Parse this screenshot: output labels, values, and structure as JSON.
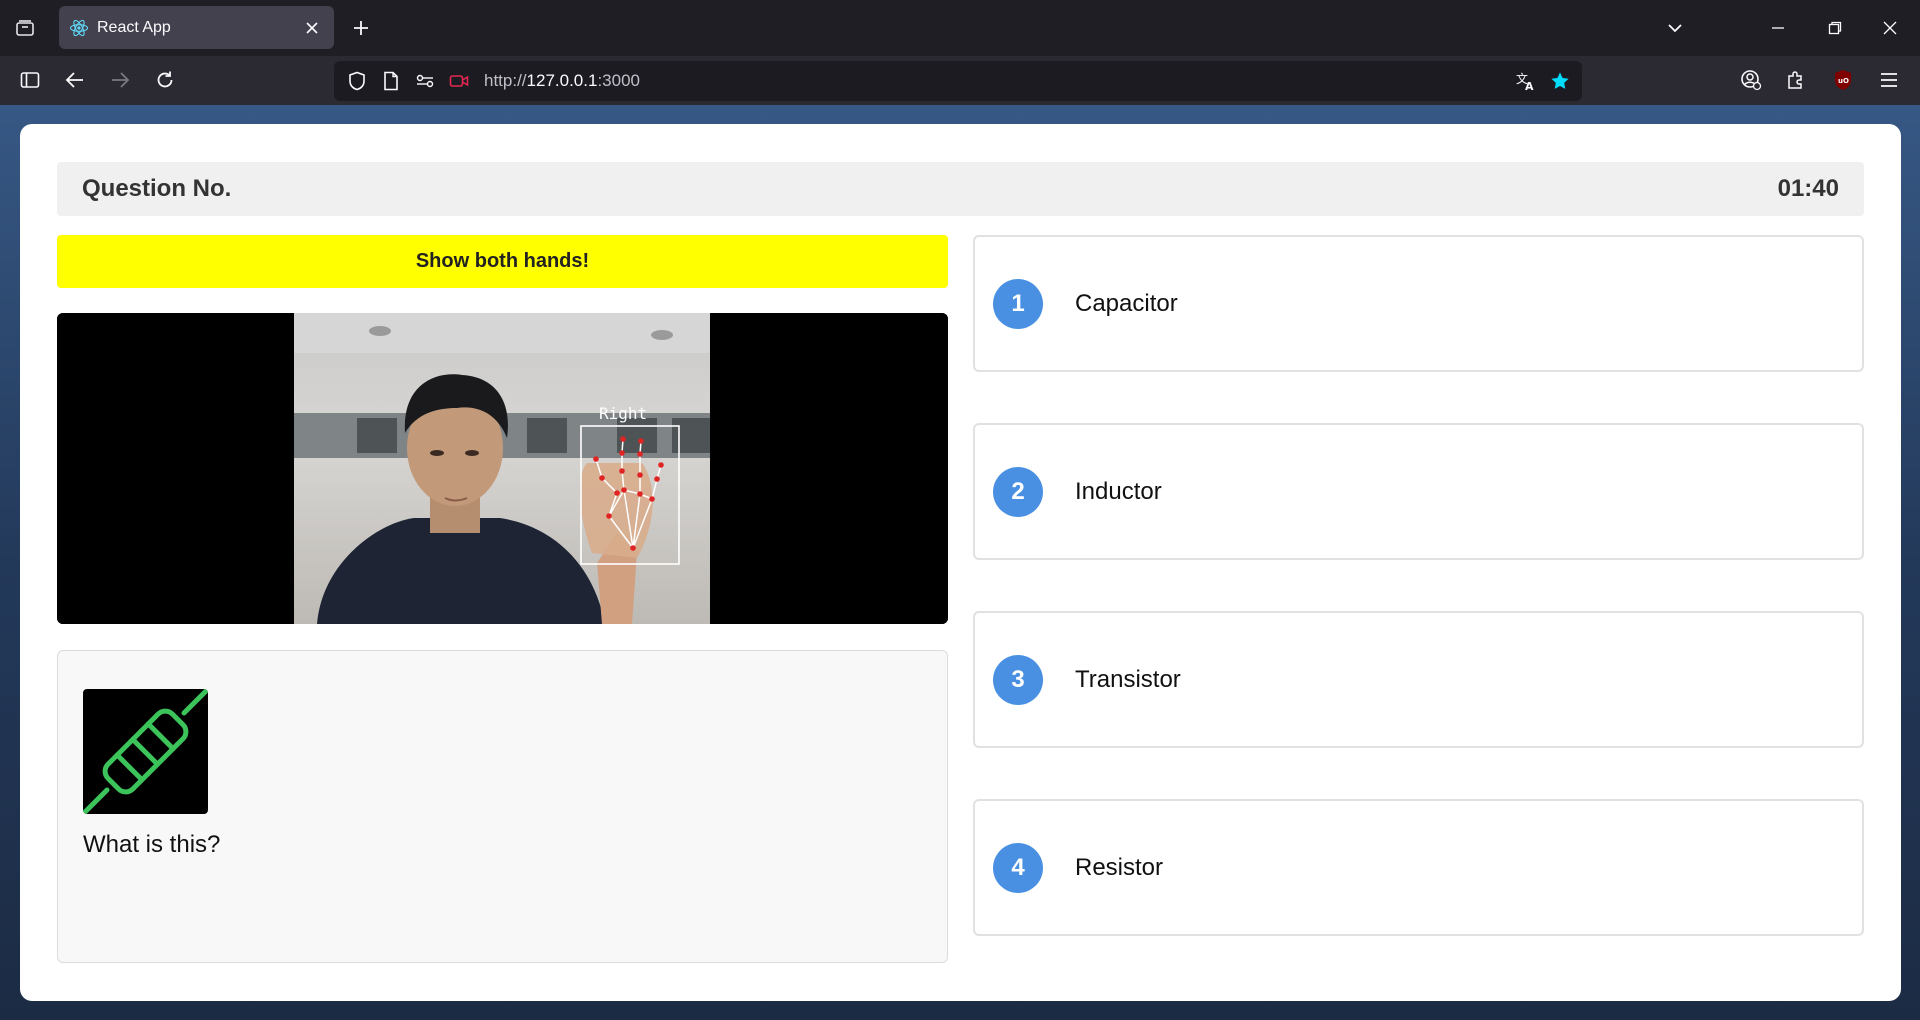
{
  "browser": {
    "tab_title": "React App",
    "url_scheme": "http://",
    "url_host": "127.0.0.1",
    "url_port": ":3000"
  },
  "header": {
    "question_label": "Question No.",
    "timer": "01:40"
  },
  "banner": {
    "message": "Show both hands!",
    "color": "#ffff00"
  },
  "camera": {
    "hand_label": "Right"
  },
  "question": {
    "text": "What is this?",
    "image_icon": "resistor-icon"
  },
  "options": [
    {
      "number": "1",
      "label": "Capacitor"
    },
    {
      "number": "2",
      "label": "Inductor"
    },
    {
      "number": "3",
      "label": "Transistor"
    },
    {
      "number": "4",
      "label": "Resistor"
    }
  ],
  "colors": {
    "accent": "#4a90e2",
    "resistor_green": "#3cc35a"
  }
}
